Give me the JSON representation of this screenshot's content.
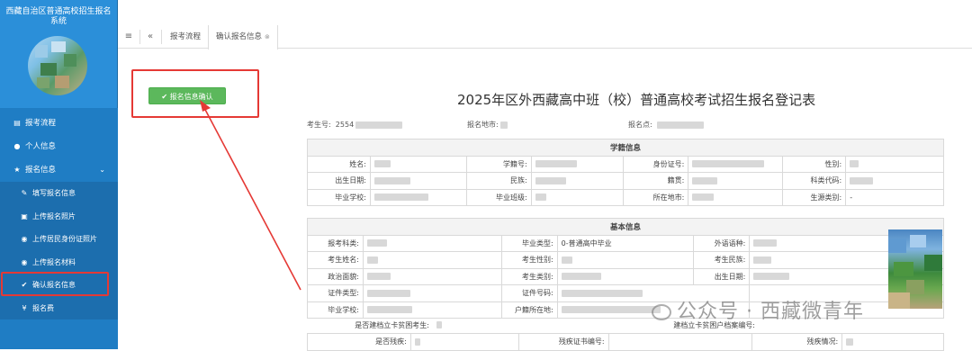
{
  "sidebar": {
    "title": "西藏自治区普通高校招生报名系统",
    "menu": [
      {
        "icon": "book-icon",
        "label": "报考流程"
      },
      {
        "icon": "user-icon",
        "label": "个人信息"
      },
      {
        "icon": "star-icon",
        "label": "报名信息"
      }
    ],
    "submenu": [
      {
        "icon": "edit-icon",
        "label": "填写报名信息"
      },
      {
        "icon": "image-icon",
        "label": "上传报名照片"
      },
      {
        "icon": "upload-icon",
        "label": "上传居民身份证照片"
      },
      {
        "icon": "upload-icon",
        "label": "上传报名材料"
      },
      {
        "icon": "check-icon",
        "label": "确认报名信息"
      },
      {
        "icon": "yen-icon",
        "label": "报名费"
      }
    ]
  },
  "tabs": {
    "items": [
      "报考流程",
      "确认报名信息"
    ]
  },
  "main": {
    "confirm_button": "报名信息确认",
    "doc_title": "2025年区外西藏高中班（校）普通高校考试招生报名登记表",
    "meta": {
      "exam_no_label": "考生号:",
      "exam_no_value": "2554",
      "city_label": "报名地市:",
      "point_label": "报名点:"
    },
    "school_section": "学籍信息",
    "school_rows": [
      [
        "姓名:",
        "",
        "学籍号:",
        "",
        "身份证号:",
        "",
        "性别:",
        ""
      ],
      [
        "出生日期:",
        "",
        "民族:",
        "",
        "籍贯:",
        "",
        "科类代码:",
        ""
      ],
      [
        "毕业学校:",
        "",
        "毕业班级:",
        "",
        "所在地市:",
        "",
        "生源类别:",
        "-"
      ]
    ],
    "basic_section": "基本信息",
    "basic_rows": [
      [
        "报考科类:",
        "",
        "毕业类型:",
        "0-普通高中毕业",
        "外语语种:",
        ""
      ],
      [
        "考生姓名:",
        "",
        "考生性别:",
        "",
        "考生民族:",
        ""
      ],
      [
        "政治面貌:",
        "",
        "考生类别:",
        "",
        "出生日期:",
        ""
      ],
      [
        "证件类型:",
        "",
        "证件号码:",
        "",
        "",
        ""
      ],
      [
        "毕业学校:",
        "",
        "户籍所在地:",
        "",
        "",
        ""
      ]
    ],
    "extra_rows": {
      "poor_label": "是否建档立卡贫困考生:",
      "poor_file_label": "建档立卡贫困户档案编号:",
      "disabled_label": "是否残疾:",
      "disabled_cert_label": "残疾证书编号:",
      "disabled_status_label": "残疾情况:"
    }
  },
  "watermark": "公众号 · 西藏微青年"
}
